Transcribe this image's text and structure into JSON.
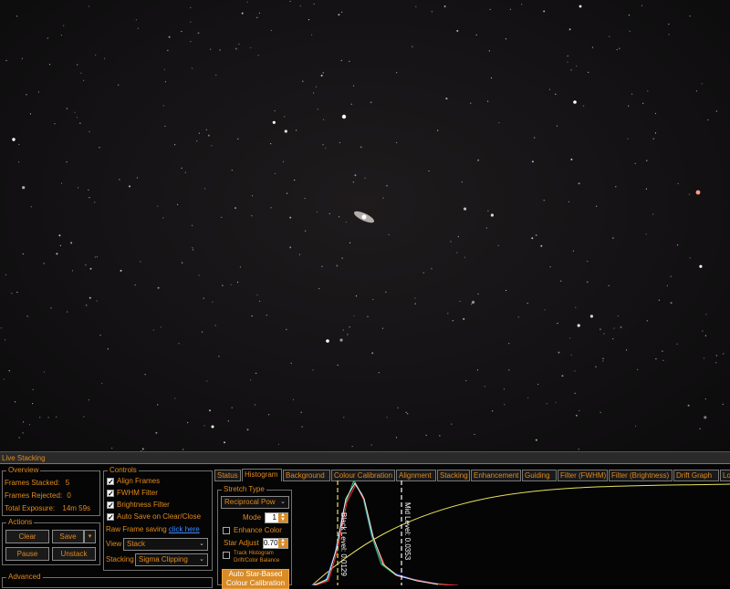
{
  "panel": {
    "title": "Live Stacking"
  },
  "overview": {
    "label": "Overview",
    "frames_stacked_label": "Frames Stacked:",
    "frames_stacked": "5",
    "frames_rejected_label": "Frames Rejected:",
    "frames_rejected": "0",
    "total_exposure_label": "Total Exposure:",
    "total_exposure": "14m 59s"
  },
  "actions": {
    "label": "Actions",
    "clear": "Clear",
    "save": "Save",
    "pause": "Pause",
    "unstack": "Unstack"
  },
  "advanced": {
    "label": "Advanced"
  },
  "controls": {
    "label": "Controls",
    "align_frames": {
      "label": "Align Frames",
      "checked": true
    },
    "fwhm_filter": {
      "label": "FWHM Filter",
      "checked": true
    },
    "brightness_filter": {
      "label": "Brightness Filter",
      "checked": true
    },
    "auto_save": {
      "label": "Auto Save on Clear/Close",
      "checked": true
    },
    "raw_frame_label": "Raw Frame saving",
    "raw_frame_link": "click here",
    "view_label": "View",
    "view_value": "Stack",
    "stacking_label": "Stacking",
    "stacking_value": "Sigma Clipping"
  },
  "tabs": [
    "Status",
    "Histogram",
    "Background",
    "Colour Calibration",
    "Alignment",
    "Stacking",
    "Enhancement",
    "Guiding",
    "Filter (FWHM)",
    "Filter (Brightness)",
    "Drift Graph",
    "Log"
  ],
  "active_tab": "Histogram",
  "stretch": {
    "label": "Stretch Type",
    "type_value": "Reciprocal Pow",
    "mode_label": "Mode",
    "mode_value": "1",
    "enhance_color_label": "Enhance Color",
    "star_adjust_label": "Star Adjust",
    "star_adjust_value": "0.70",
    "track_histogram_label": "Track Histogram",
    "drift_balance_label": "Drift/Color Balance",
    "auto_star_button_line1": "Auto Star-Based",
    "auto_star_button_line2": "Colour Calibration"
  },
  "histogram": {
    "black_level_label": "Black Level: 0.0129",
    "mid_level_label": "Mid Level: 0.0353"
  },
  "colors": {
    "accent": "#e08a1e",
    "link": "#3d8cff",
    "button_orange": "#d98b26"
  }
}
